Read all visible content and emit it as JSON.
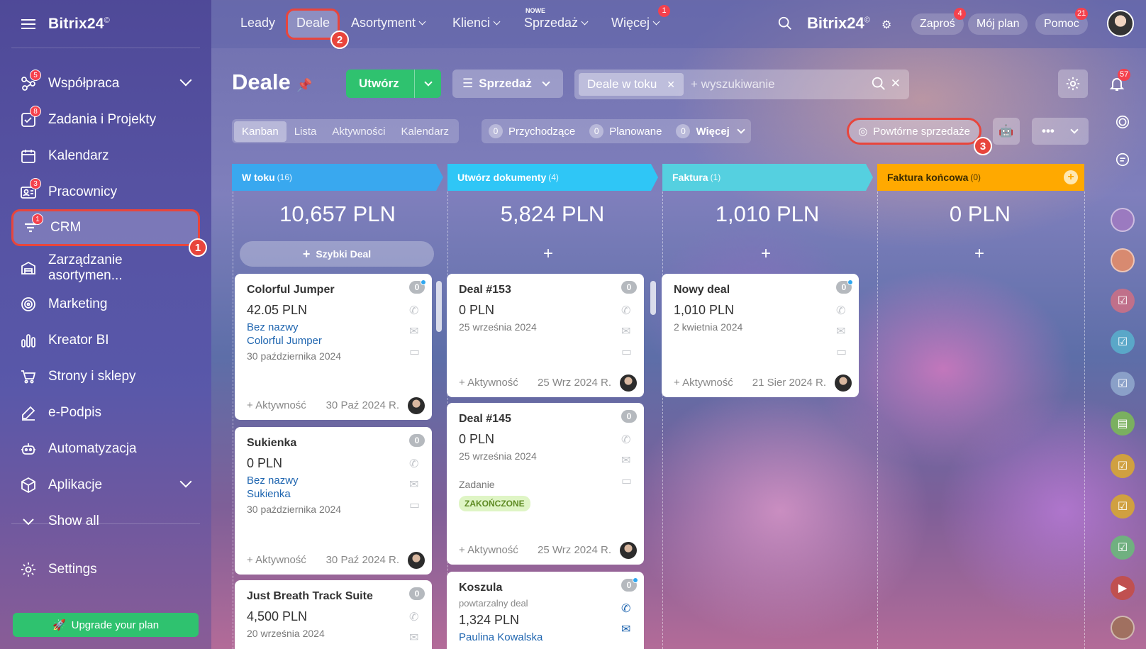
{
  "app": {
    "logo": "Bitrix24",
    "logo_mark": "©",
    "title_logo": "Bitrix24"
  },
  "sidebar": {
    "items": [
      {
        "label": "Współpraca",
        "badge": "5",
        "icon": "collab-icon",
        "expand": true
      },
      {
        "label": "Zadania i Projekty",
        "badge": "8",
        "icon": "tasks-icon"
      },
      {
        "label": "Kalendarz",
        "badge": "",
        "icon": "calendar-icon"
      },
      {
        "label": "Pracownicy",
        "badge": "3",
        "icon": "employees-icon"
      },
      {
        "label": "CRM",
        "badge": "1",
        "icon": "crm-icon"
      },
      {
        "label": "Zarządzanie asortymen...",
        "badge": "",
        "icon": "inventory-icon"
      },
      {
        "label": "Marketing",
        "badge": "",
        "icon": "marketing-icon"
      },
      {
        "label": "Kreator BI",
        "badge": "",
        "icon": "bi-icon"
      },
      {
        "label": "Strony i sklepy",
        "badge": "",
        "icon": "cart-icon"
      },
      {
        "label": "e-Podpis",
        "badge": "",
        "icon": "sign-icon"
      },
      {
        "label": "Automatyzacja",
        "badge": "",
        "icon": "robot-icon"
      },
      {
        "label": "Aplikacje",
        "badge": "",
        "icon": "apps-icon",
        "expand": true
      },
      {
        "label": "Show all",
        "badge": "",
        "icon": "chevron-down-icon"
      }
    ],
    "settings": "Settings",
    "upgrade": "Upgrade your plan"
  },
  "topnav": {
    "items": [
      "Leady",
      "Deale",
      "Asortyment",
      "Klienci",
      "Sprzedaż",
      "Więcej"
    ],
    "new_label": "NOWE",
    "more_badge": "1",
    "invite": "Zaproś",
    "invite_badge": "4",
    "my_plan": "Mój plan",
    "help": "Pomoc",
    "help_badge": "21"
  },
  "markers": [
    "1",
    "2",
    "3"
  ],
  "page": {
    "title": "Deale",
    "create": "Utwórz",
    "pipeline": "Sprzedaż",
    "filter_chip": "Deale w toku",
    "search_placeholder": "+ wyszukiwanie",
    "notifications_badge": "57"
  },
  "views": [
    "Kanban",
    "Lista",
    "Aktywności",
    "Kalendarz"
  ],
  "counters": [
    {
      "n": "0",
      "label": "Przychodzące"
    },
    {
      "n": "0",
      "label": "Planowane"
    },
    {
      "n": "0",
      "label": "Więcej"
    }
  ],
  "repeat_sales": "Powtórne sprzedaże",
  "quick_deal": "Szybki Deal",
  "columns": [
    {
      "name": "W toku",
      "count": "(16)",
      "sum": "10,657 PLN",
      "color": "#39a8ef"
    },
    {
      "name": "Utwórz dokumenty",
      "count": "(4)",
      "sum": "5,824 PLN",
      "color": "#2fc6f6"
    },
    {
      "name": "Faktura",
      "count": "(1)",
      "sum": "1,010 PLN",
      "color": "#55d0e0"
    },
    {
      "name": "Faktura końcowa",
      "count": "(0)",
      "sum": "0 PLN",
      "color": "#ffa900"
    }
  ],
  "cards": {
    "c1": {
      "name": "Colorful Jumper",
      "price": "42.05 PLN",
      "link1": "Bez nazwy",
      "link2": "Colorful Jumper",
      "date": "30 października 2024",
      "activity": "+ Aktywność",
      "adate": "30 Paź 2024 R.",
      "count": "0"
    },
    "c2": {
      "name": "Sukienka",
      "price": "0 PLN",
      "link1": "Bez nazwy",
      "link2": "Sukienka",
      "date": "30 października 2024",
      "activity": "+ Aktywność",
      "adate": "30 Paź 2024 R.",
      "count": "0"
    },
    "c3": {
      "name": "Just Breath Track Suite",
      "price": "4,500 PLN",
      "date": "20 września 2024",
      "count": "0"
    },
    "c4": {
      "name": "Deal #153",
      "price": "0 PLN",
      "date": "25 września 2024",
      "activity": "+ Aktywność",
      "adate": "25 Wrz 2024 R.",
      "count": "0"
    },
    "c5": {
      "name": "Deal #145",
      "price": "0 PLN",
      "date": "25 września 2024",
      "task": "Zadanie",
      "status": "ZAKOŃCZONE",
      "activity": "+ Aktywność",
      "adate": "25 Wrz 2024 R.",
      "count": "0"
    },
    "c6": {
      "name": "Koszula",
      "sub": "powtarzalny deal",
      "price": "1,324 PLN",
      "contact": "Paulina Kowalska",
      "count": "0"
    },
    "c7": {
      "name": "Nowy deal",
      "price": "1,010 PLN",
      "date": "2 kwietnia 2024",
      "activity": "+ Aktywność",
      "adate": "21 Sier 2024 R.",
      "count": "0"
    }
  }
}
